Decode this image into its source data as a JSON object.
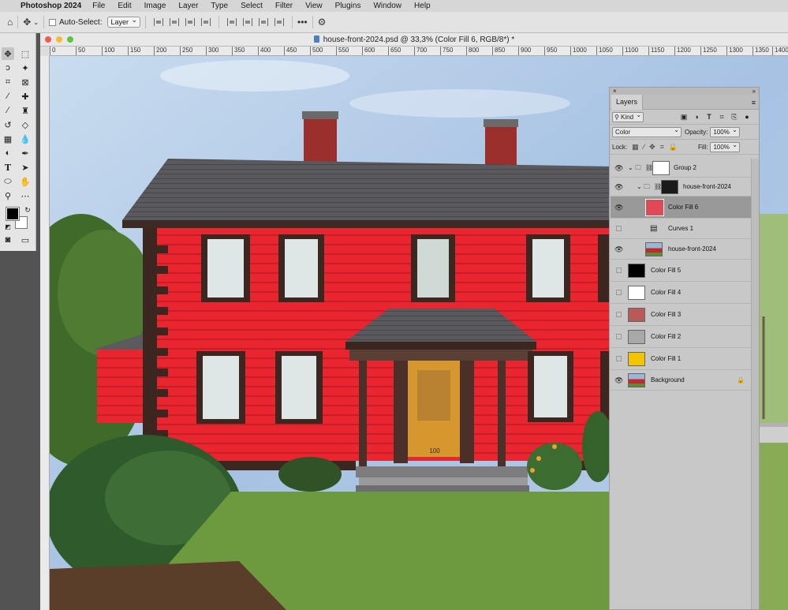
{
  "menubar": {
    "app_name": "Photoshop 2024",
    "items": [
      "File",
      "Edit",
      "Image",
      "Layer",
      "Type",
      "Select",
      "Filter",
      "View",
      "Plugins",
      "Window",
      "Help"
    ]
  },
  "options_bar": {
    "auto_select_label": "Auto-Select:",
    "auto_select_value": "Layer"
  },
  "document": {
    "title": "house-front-2024.psd @ 33,3% (Color Fill 6, RGB/8*) *",
    "ruler_labels": [
      "0",
      "50",
      "100",
      "150",
      "200",
      "250",
      "300",
      "350",
      "400",
      "450",
      "500",
      "550",
      "600",
      "650",
      "700",
      "750",
      "800",
      "850",
      "900",
      "950",
      "1000",
      "1050",
      "1100",
      "1150",
      "1200",
      "1250",
      "1300",
      "1350",
      "1400"
    ],
    "door_number": "100"
  },
  "layers_panel": {
    "tab_label": "Layers",
    "filter_kind": "Kind",
    "blend_mode": "Color",
    "opacity_label": "Opacity:",
    "opacity_value": "100%",
    "lock_label": "Lock:",
    "fill_label": "Fill:",
    "fill_value": "100%",
    "layers": [
      {
        "name": "Group 2",
        "visible": true
      },
      {
        "name": "house-front-2024",
        "visible": true
      },
      {
        "name": "Color Fill 6",
        "visible": true,
        "selected": true,
        "color": "#e04a55"
      },
      {
        "name": "Curves 1",
        "visible": false
      },
      {
        "name": "house-front-2024",
        "visible": true
      },
      {
        "name": "Color Fill 5",
        "visible": false,
        "color": "#000000"
      },
      {
        "name": "Color Fill 4",
        "visible": false,
        "color": "#ffffff"
      },
      {
        "name": "Color Fill 3",
        "visible": false,
        "color": "#b85a5a"
      },
      {
        "name": "Color Fill 2",
        "visible": false,
        "color": "#a8a8a8"
      },
      {
        "name": "Color Fill 1",
        "visible": false,
        "color": "#f2c500"
      },
      {
        "name": "Background",
        "visible": true
      }
    ]
  },
  "colors": {
    "foreground": "#000000",
    "background": "#ffffff",
    "house": "#e8262e",
    "door": "#d6972f"
  }
}
